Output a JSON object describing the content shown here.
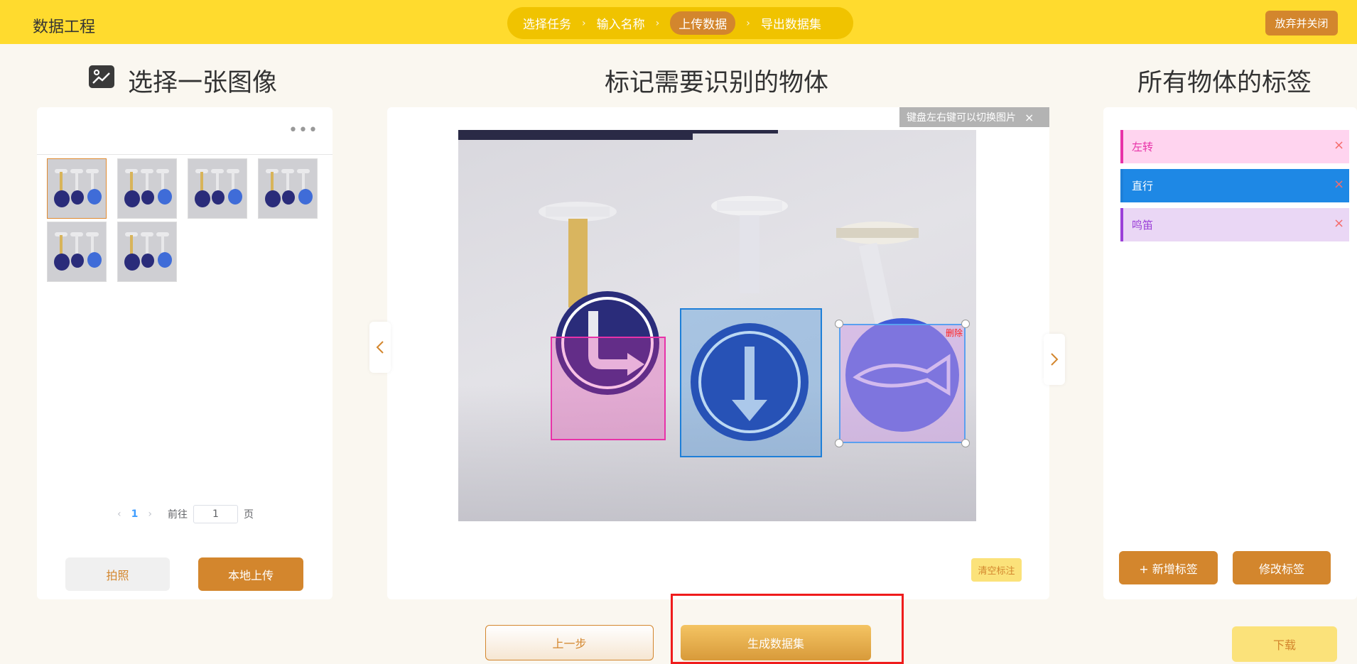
{
  "header": {
    "title": "数据工程",
    "steps": [
      "选择任务",
      "输入名称",
      "上传数据",
      "导出数据集"
    ],
    "active_step": 2,
    "close_label": "放弃并关闭",
    "bg_color": "#ffdb2e",
    "accent_color": "#d3862d"
  },
  "left": {
    "title": "选择一张图像",
    "title_icon": "image-icon",
    "more_icon": "more-icon",
    "thumbnail_count": 6,
    "selected_index": 0,
    "pagination": {
      "current_page": "1",
      "goto_label": "前往",
      "goto_value": "1",
      "page_unit": "页"
    },
    "photo_label": "拍照",
    "upload_label": "本地上传"
  },
  "center": {
    "title": "标记需要识别的物体",
    "hint": "键盘左右键可以切换图片",
    "hint_close": "×",
    "delete_label": "删除",
    "clear_label": "清空标注",
    "prev_icon": "chevron-left-icon",
    "next_icon": "chevron-right-icon"
  },
  "right": {
    "title": "所有物体的标签",
    "tags": [
      {
        "label": "左转",
        "color": "#e832a8",
        "bg": "#ffd4ef"
      },
      {
        "label": "直行",
        "color": "#1e7fd8",
        "bg": "#1e88e5"
      },
      {
        "label": "鸣笛",
        "color": "#9b40d8",
        "bg": "#ead7f5"
      }
    ],
    "remove_icon": "×",
    "add_label": "+ 新增标签",
    "edit_label": "修改标签"
  },
  "footer": {
    "prev_label": "上一步",
    "generate_label": "生成数据集",
    "download_label": "下载"
  }
}
